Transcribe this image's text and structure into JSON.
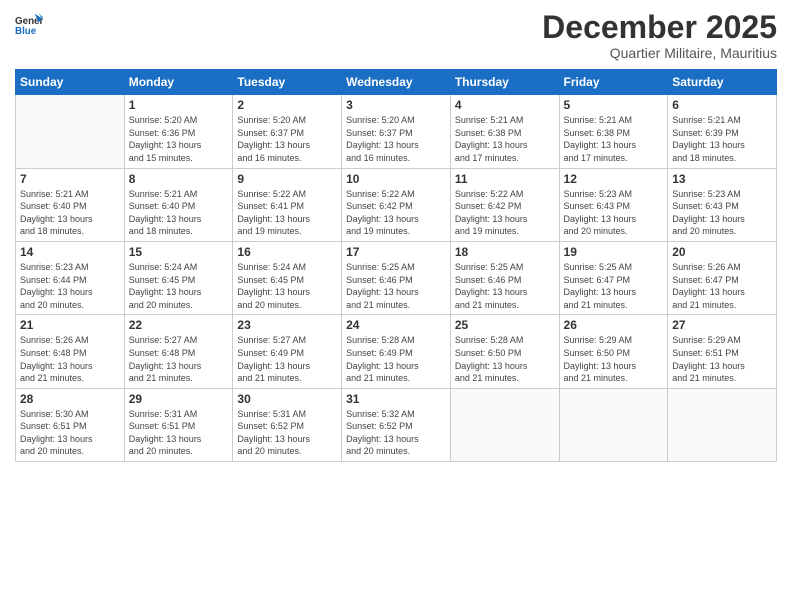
{
  "logo": {
    "general": "General",
    "blue": "Blue"
  },
  "header": {
    "month": "December 2025",
    "location": "Quartier Militaire, Mauritius"
  },
  "weekdays": [
    "Sunday",
    "Monday",
    "Tuesday",
    "Wednesday",
    "Thursday",
    "Friday",
    "Saturday"
  ],
  "weeks": [
    [
      {
        "day": "",
        "info": ""
      },
      {
        "day": "1",
        "info": "Sunrise: 5:20 AM\nSunset: 6:36 PM\nDaylight: 13 hours\nand 15 minutes."
      },
      {
        "day": "2",
        "info": "Sunrise: 5:20 AM\nSunset: 6:37 PM\nDaylight: 13 hours\nand 16 minutes."
      },
      {
        "day": "3",
        "info": "Sunrise: 5:20 AM\nSunset: 6:37 PM\nDaylight: 13 hours\nand 16 minutes."
      },
      {
        "day": "4",
        "info": "Sunrise: 5:21 AM\nSunset: 6:38 PM\nDaylight: 13 hours\nand 17 minutes."
      },
      {
        "day": "5",
        "info": "Sunrise: 5:21 AM\nSunset: 6:38 PM\nDaylight: 13 hours\nand 17 minutes."
      },
      {
        "day": "6",
        "info": "Sunrise: 5:21 AM\nSunset: 6:39 PM\nDaylight: 13 hours\nand 18 minutes."
      }
    ],
    [
      {
        "day": "7",
        "info": "Sunrise: 5:21 AM\nSunset: 6:40 PM\nDaylight: 13 hours\nand 18 minutes."
      },
      {
        "day": "8",
        "info": "Sunrise: 5:21 AM\nSunset: 6:40 PM\nDaylight: 13 hours\nand 18 minutes."
      },
      {
        "day": "9",
        "info": "Sunrise: 5:22 AM\nSunset: 6:41 PM\nDaylight: 13 hours\nand 19 minutes."
      },
      {
        "day": "10",
        "info": "Sunrise: 5:22 AM\nSunset: 6:42 PM\nDaylight: 13 hours\nand 19 minutes."
      },
      {
        "day": "11",
        "info": "Sunrise: 5:22 AM\nSunset: 6:42 PM\nDaylight: 13 hours\nand 19 minutes."
      },
      {
        "day": "12",
        "info": "Sunrise: 5:23 AM\nSunset: 6:43 PM\nDaylight: 13 hours\nand 20 minutes."
      },
      {
        "day": "13",
        "info": "Sunrise: 5:23 AM\nSunset: 6:43 PM\nDaylight: 13 hours\nand 20 minutes."
      }
    ],
    [
      {
        "day": "14",
        "info": "Sunrise: 5:23 AM\nSunset: 6:44 PM\nDaylight: 13 hours\nand 20 minutes."
      },
      {
        "day": "15",
        "info": "Sunrise: 5:24 AM\nSunset: 6:45 PM\nDaylight: 13 hours\nand 20 minutes."
      },
      {
        "day": "16",
        "info": "Sunrise: 5:24 AM\nSunset: 6:45 PM\nDaylight: 13 hours\nand 20 minutes."
      },
      {
        "day": "17",
        "info": "Sunrise: 5:25 AM\nSunset: 6:46 PM\nDaylight: 13 hours\nand 21 minutes."
      },
      {
        "day": "18",
        "info": "Sunrise: 5:25 AM\nSunset: 6:46 PM\nDaylight: 13 hours\nand 21 minutes."
      },
      {
        "day": "19",
        "info": "Sunrise: 5:25 AM\nSunset: 6:47 PM\nDaylight: 13 hours\nand 21 minutes."
      },
      {
        "day": "20",
        "info": "Sunrise: 5:26 AM\nSunset: 6:47 PM\nDaylight: 13 hours\nand 21 minutes."
      }
    ],
    [
      {
        "day": "21",
        "info": "Sunrise: 5:26 AM\nSunset: 6:48 PM\nDaylight: 13 hours\nand 21 minutes."
      },
      {
        "day": "22",
        "info": "Sunrise: 5:27 AM\nSunset: 6:48 PM\nDaylight: 13 hours\nand 21 minutes."
      },
      {
        "day": "23",
        "info": "Sunrise: 5:27 AM\nSunset: 6:49 PM\nDaylight: 13 hours\nand 21 minutes."
      },
      {
        "day": "24",
        "info": "Sunrise: 5:28 AM\nSunset: 6:49 PM\nDaylight: 13 hours\nand 21 minutes."
      },
      {
        "day": "25",
        "info": "Sunrise: 5:28 AM\nSunset: 6:50 PM\nDaylight: 13 hours\nand 21 minutes."
      },
      {
        "day": "26",
        "info": "Sunrise: 5:29 AM\nSunset: 6:50 PM\nDaylight: 13 hours\nand 21 minutes."
      },
      {
        "day": "27",
        "info": "Sunrise: 5:29 AM\nSunset: 6:51 PM\nDaylight: 13 hours\nand 21 minutes."
      }
    ],
    [
      {
        "day": "28",
        "info": "Sunrise: 5:30 AM\nSunset: 6:51 PM\nDaylight: 13 hours\nand 20 minutes."
      },
      {
        "day": "29",
        "info": "Sunrise: 5:31 AM\nSunset: 6:51 PM\nDaylight: 13 hours\nand 20 minutes."
      },
      {
        "day": "30",
        "info": "Sunrise: 5:31 AM\nSunset: 6:52 PM\nDaylight: 13 hours\nand 20 minutes."
      },
      {
        "day": "31",
        "info": "Sunrise: 5:32 AM\nSunset: 6:52 PM\nDaylight: 13 hours\nand 20 minutes."
      },
      {
        "day": "",
        "info": ""
      },
      {
        "day": "",
        "info": ""
      },
      {
        "day": "",
        "info": ""
      }
    ]
  ]
}
